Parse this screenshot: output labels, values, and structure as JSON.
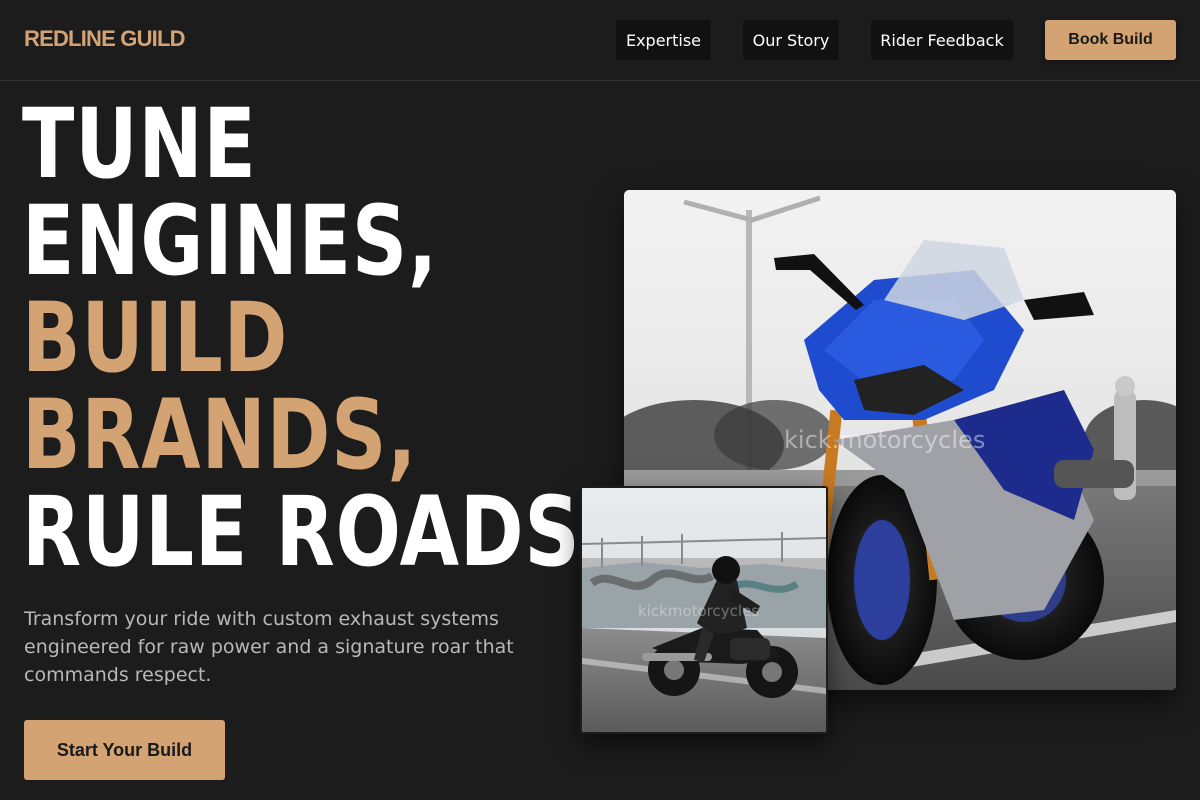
{
  "header": {
    "logo": "REDLINE GUILD",
    "nav": [
      "Expertise",
      "Our Story",
      "Rider Feedback"
    ],
    "book_label": "Book Build"
  },
  "hero": {
    "headline_lines": [
      "TUNE",
      "ENGINES,",
      "BUILD",
      "BRANDS,",
      "RULE ROADS."
    ],
    "subtitle": "Transform your ride with custom exhaust systems engineered for raw power and a signature roar that commands respect.",
    "cta_label": "Start Your Build"
  },
  "images": {
    "main_watermark": "kick.motorcycles",
    "inset_watermark": "kickmotorcycles"
  },
  "colors": {
    "accent": "#d4a373",
    "background": "#1c1c1c",
    "nav_button": "#111111"
  }
}
